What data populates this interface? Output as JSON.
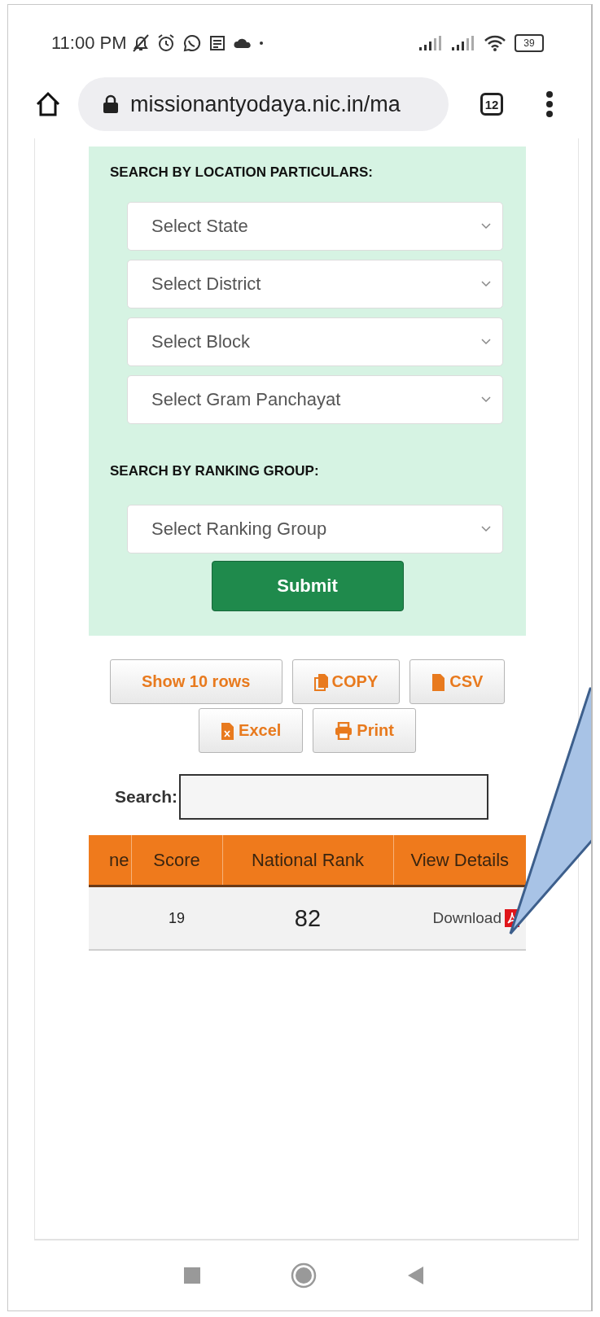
{
  "status_bar": {
    "time": "11:00 PM",
    "battery": "39"
  },
  "browser": {
    "url": "missionantyodaya.nic.in/ma",
    "tab_count": "12"
  },
  "location_search": {
    "heading": "SEARCH BY LOCATION PARTICULARS:",
    "selects": [
      {
        "placeholder": "Select State"
      },
      {
        "placeholder": "Select District"
      },
      {
        "placeholder": "Select Block"
      },
      {
        "placeholder": "Select Gram Panchayat"
      }
    ]
  },
  "ranking_search": {
    "heading": "SEARCH BY RANKING GROUP:",
    "select": {
      "placeholder": "Select Ranking Group"
    }
  },
  "submit_button": "Submit",
  "export_buttons": [
    {
      "label": "Show 10 rows",
      "kind": "plain"
    },
    {
      "label": "COPY",
      "kind": "copy"
    },
    {
      "label": "CSV",
      "kind": "csv"
    },
    {
      "label": "Excel",
      "kind": "excel"
    },
    {
      "label": "Print",
      "kind": "print"
    }
  ],
  "search": {
    "label": "Search:"
  },
  "table": {
    "columns": [
      "ne",
      "Score",
      "National Rank",
      "View Details"
    ],
    "rows": [
      {
        "score": "19",
        "national_rank": "82",
        "view_details": "Download"
      }
    ]
  }
}
